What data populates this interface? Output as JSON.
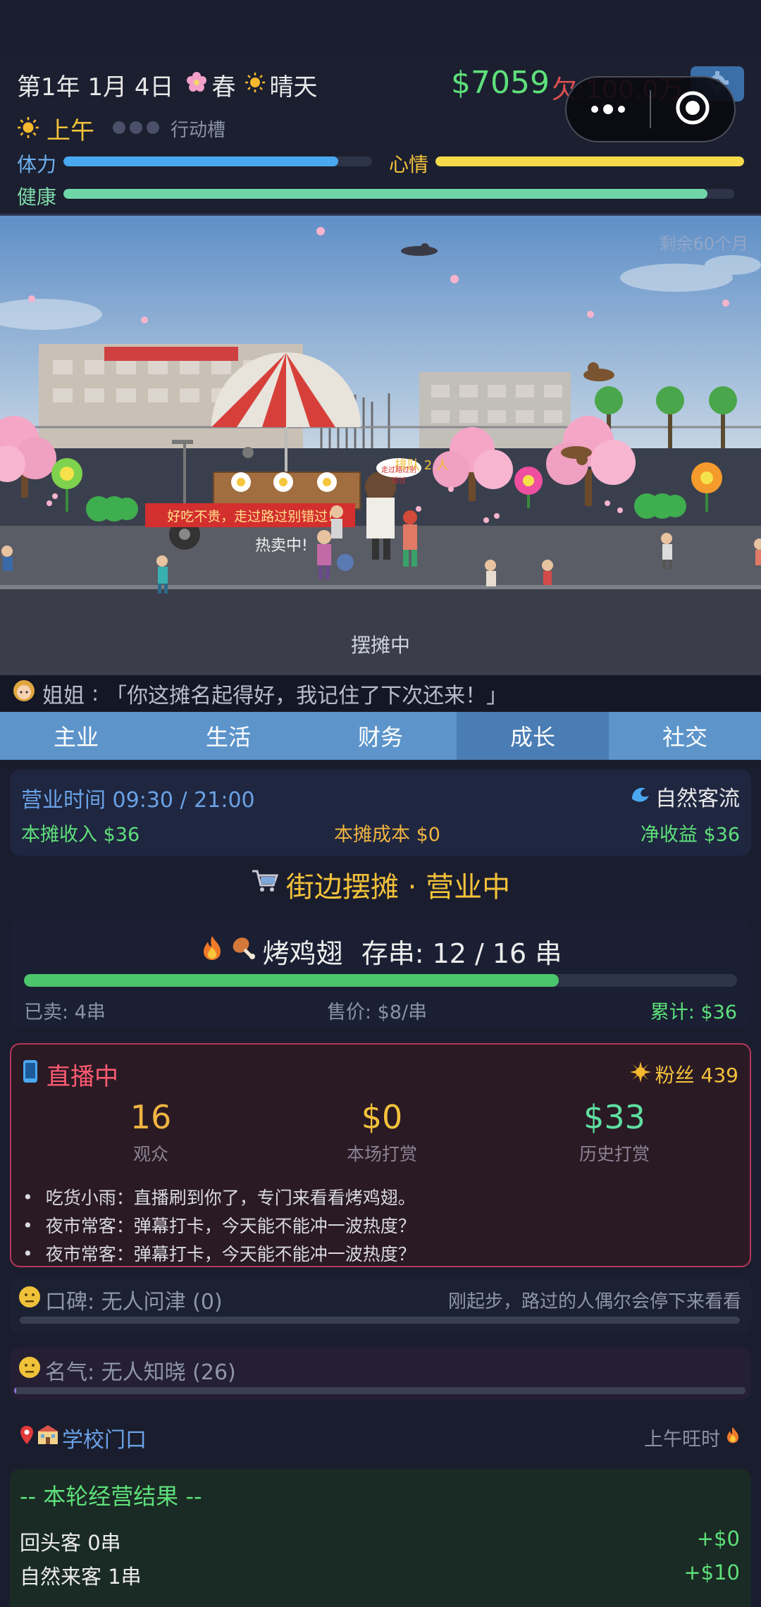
{
  "header": {
    "date": "第1年 1月 4日",
    "season": "春",
    "weather": "晴天",
    "money": "$7059",
    "debt": "欠:100.0万",
    "time_of_day": "上午",
    "action_slots_label": "行动槽",
    "stats": {
      "stamina_label": "体力",
      "stamina": 0.89,
      "mood_label": "心情",
      "mood": 1.0,
      "health_label": "健康",
      "health": 0.96
    }
  },
  "scene": {
    "months_left": "剩余60个月",
    "banner": "好吃不贵，走过路过别错过!",
    "hot_selling": "热卖中!",
    "queue_label": "排队 2 人",
    "speech_bubble": "走过路过别错过",
    "status": "摆摊中"
  },
  "dialogue": {
    "speaker": "姐姐",
    "text": "「你这摊名起得好，我记住了下次还来！」"
  },
  "tabs": [
    {
      "label": "主业",
      "active": false
    },
    {
      "label": "生活",
      "active": false
    },
    {
      "label": "财务",
      "active": false
    },
    {
      "label": "成长",
      "active": true
    },
    {
      "label": "社交",
      "active": false
    }
  ],
  "business": {
    "hours": "营业时间 09:30 / 21:00",
    "flow": "自然客流",
    "income": "本摊收入 $36",
    "cost": "本摊成本 $0",
    "net": "净收益 $36"
  },
  "stall_title": "街边摆摊 · 营业中",
  "stock": {
    "item": "烤鸡翅",
    "stock_text": "存串: 12 / 16 串",
    "fill": 0.75,
    "sold": "已卖: 4串",
    "price": "售价: $8/串",
    "total": "累计: $36"
  },
  "live": {
    "title": "直播中",
    "fans": "粉丝 439",
    "viewers": "16",
    "viewers_label": "观众",
    "tips": "$0",
    "tips_label": "本场打赏",
    "history_tips": "$33",
    "history_tips_label": "历史打赏",
    "comments": [
      "吃货小雨：直播刷到你了，专门来看看烤鸡翅。",
      "夜市常客：弹幕打卡，今天能不能冲一波热度？",
      "夜市常客：弹幕打卡，今天能不能冲一波热度？"
    ]
  },
  "reputation": {
    "text": "口碑: 无人问津 (0)",
    "hint": "刚起步，路过的人偶尔会停下来看看",
    "fill": 0.0
  },
  "fame": {
    "text": "名气: 无人知晓 (26)",
    "fill": 0.003
  },
  "location": {
    "name": "学校门口",
    "peak": "上午旺时"
  },
  "result": {
    "title": "-- 本轮经营结果 --",
    "rows": [
      {
        "label": "回头客 0串",
        "amount": "+$0"
      },
      {
        "label": "自然来客 1串",
        "amount": "+$10"
      }
    ]
  },
  "colors": {
    "accent_blue": "#5d95cb",
    "money_green": "#5ee07a",
    "debt_red": "#e05050",
    "gold": "#f3c23b",
    "live_red": "#ff5b72"
  }
}
